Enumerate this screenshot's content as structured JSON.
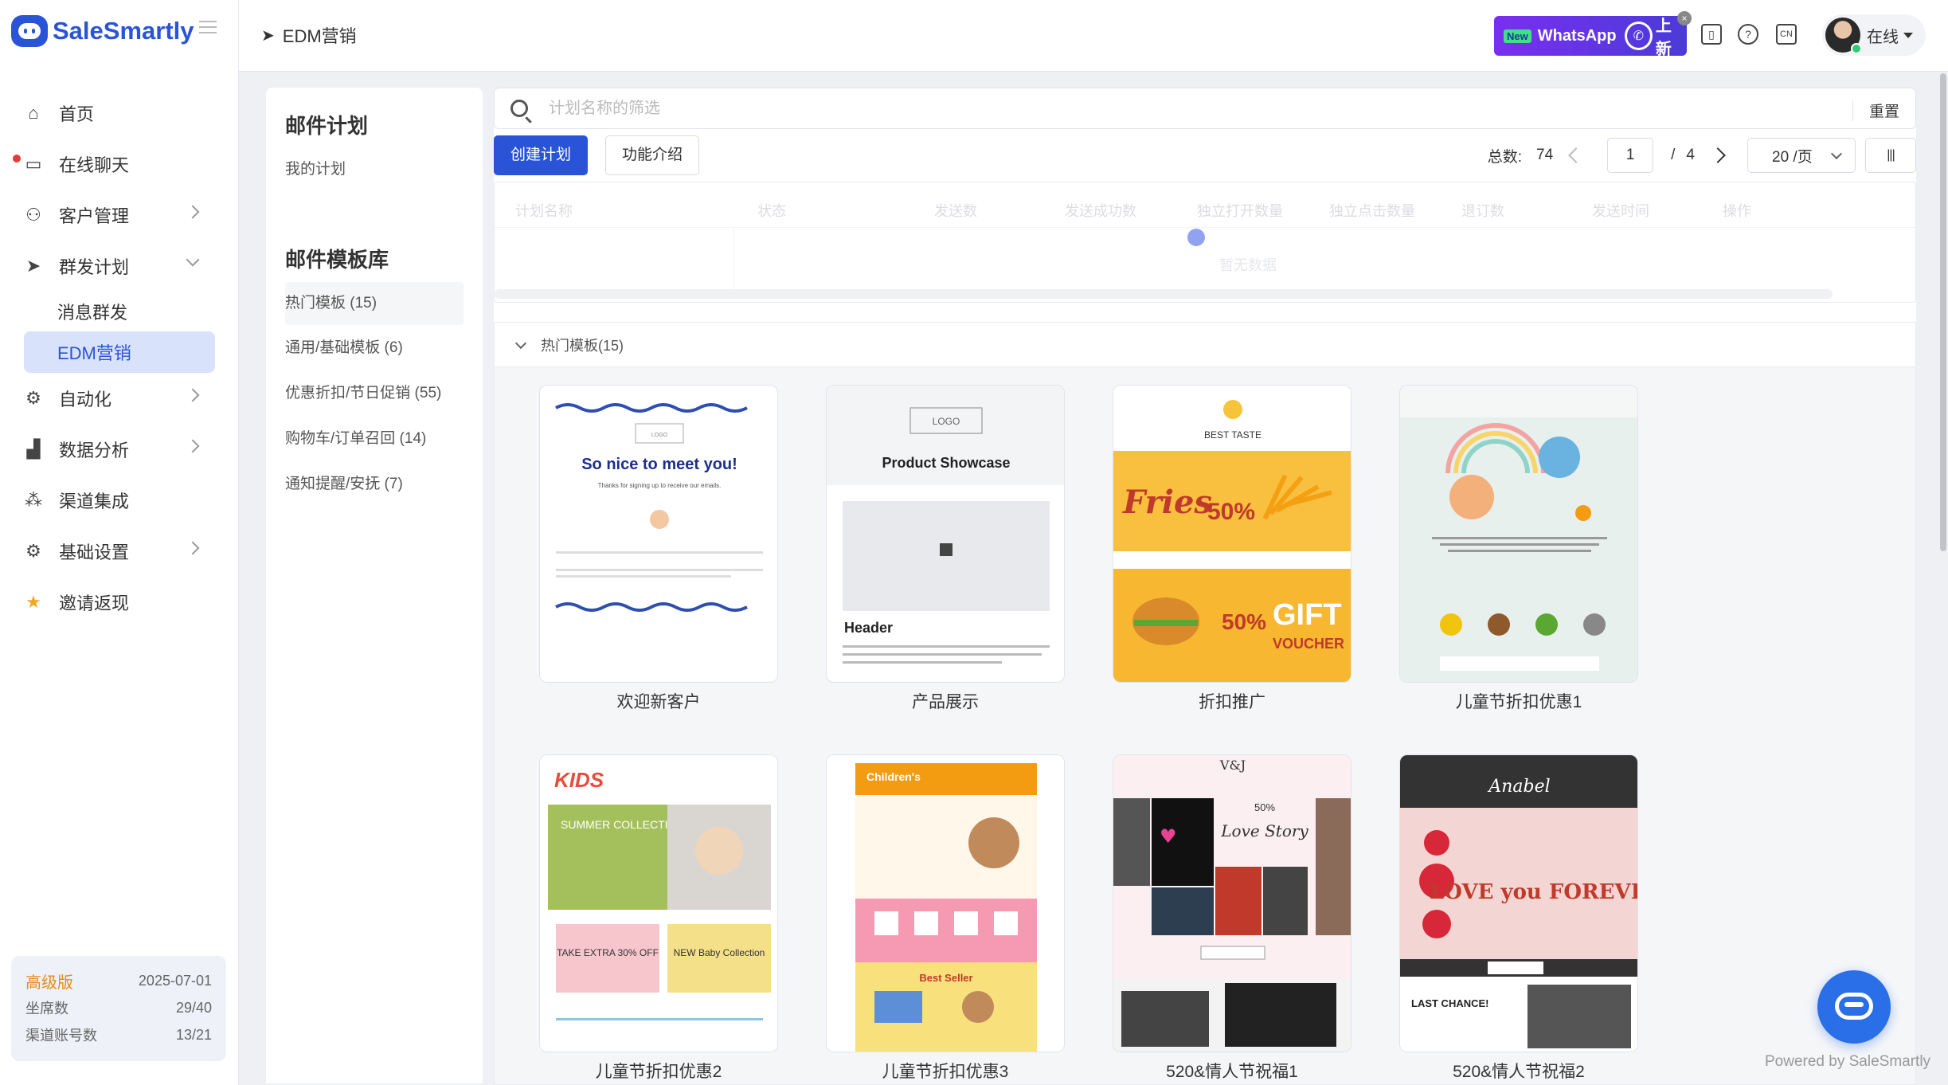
{
  "app": {
    "name": "SaleSmartly"
  },
  "sidebar": {
    "items": [
      {
        "label": "首页",
        "icon": "home-icon"
      },
      {
        "label": "在线聊天",
        "icon": "chat-icon"
      },
      {
        "label": "客户管理",
        "icon": "users-icon"
      },
      {
        "label": "群发计划",
        "icon": "send-icon"
      },
      {
        "label": "自动化",
        "icon": "robot-icon"
      },
      {
        "label": "数据分析",
        "icon": "chart-icon"
      },
      {
        "label": "渠道集成",
        "icon": "channels-icon"
      },
      {
        "label": "基础设置",
        "icon": "gear-icon"
      },
      {
        "label": "邀请返现",
        "icon": "star-icon"
      }
    ],
    "sub_items": [
      {
        "label": "消息群发"
      },
      {
        "label": "EDM营销"
      }
    ],
    "plan": {
      "name": "高级版",
      "expiry": "2025-07-01",
      "seats_label": "坐席数",
      "seats_value": "29/40",
      "channels_label": "渠道账号数",
      "channels_value": "13/21"
    }
  },
  "topbar": {
    "breadcrumb": "EDM营销",
    "whatsapp_badge": "New",
    "whatsapp_label": "WhatsApp",
    "whatsapp_new": "上新",
    "lang": "CN",
    "user_status": "在线"
  },
  "left_panel": {
    "plans_title": "邮件计划",
    "my_plans": "我的计划",
    "templates_title": "邮件模板库",
    "categories": [
      {
        "label": "热门模板 (15)"
      },
      {
        "label": "通用/基础模板 (6)"
      },
      {
        "label": "优惠折扣/节日促销 (55)"
      },
      {
        "label": "购物车/订单召回 (14)"
      },
      {
        "label": "通知提醒/安抚 (7)"
      }
    ]
  },
  "main": {
    "search_placeholder": "计划名称的筛选",
    "reset": "重置",
    "create_button": "创建计划",
    "intro_button": "功能介绍",
    "pager": {
      "total_label": "总数:",
      "total": "74",
      "page": "1",
      "sep": "/",
      "pages": "4",
      "size": "20 /页",
      "cols_icon": "|||"
    },
    "table_headers": [
      "计划名称",
      "状态",
      "发送数",
      "发送成功数",
      "独立打开数量",
      "独立点击数量",
      "退订数",
      "发送时间",
      "操作"
    ],
    "empty_text": "暂无数据",
    "templates_section": "热门模板(15)",
    "templates": [
      {
        "caption": "欢迎新客户"
      },
      {
        "caption": "产品展示"
      },
      {
        "caption": "折扣推广"
      },
      {
        "caption": "儿童节折扣优惠1"
      },
      {
        "caption": "儿童节折扣优惠2"
      },
      {
        "caption": "儿童节折扣优惠3"
      },
      {
        "caption": "520&情人节祝福1"
      },
      {
        "caption": "520&情人节祝福2"
      }
    ],
    "thumb_text": {
      "welcome_title": "So nice to meet you!",
      "welcome_sub": "Thanks for signing up to receive our emails.",
      "product_title": "Product Showcase",
      "product_header": "Header",
      "fries": "Fries",
      "fries_pct": "50%",
      "best_taste": "BEST TASTE",
      "gift": "GIFT",
      "voucher": "VOUCHER",
      "kids": "KIDS",
      "summer": "SUMMER COLLECTION",
      "take_extra": "TAKE EXTRA 30% OFF",
      "baby_collection": "NEW Baby Collection",
      "childrens": "Children's",
      "best_seller": "Best Seller",
      "vj": "V&J",
      "love_story": "Love Story",
      "anabel": "Anabel",
      "love_forever": "LOVE you FOREVER",
      "last_chance": "LAST CHANCE!"
    }
  },
  "footer": {
    "powered": "Powered by SaleSmartly"
  }
}
